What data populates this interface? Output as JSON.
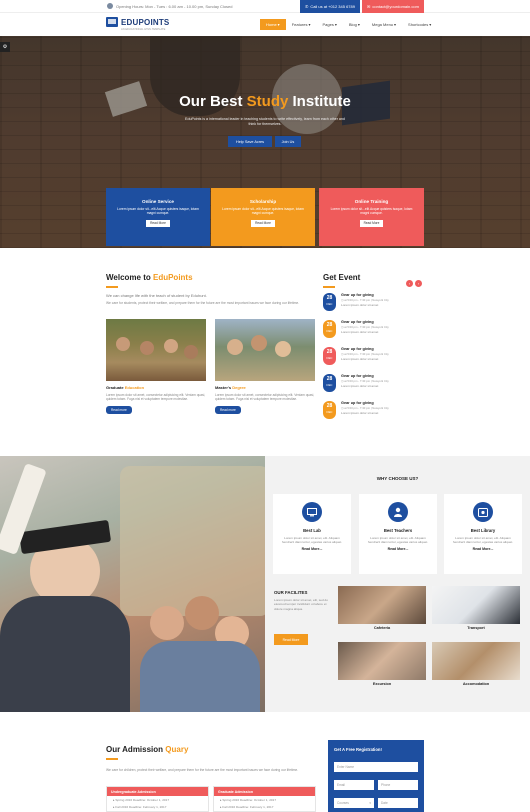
{
  "topbar": {
    "hours": "Opening Hours: Mon - Tues : 6.00 am - 10.00 pm, Sunday Closed",
    "call": "Call us at +012 345 6789",
    "email": "contact@yourdomain.com"
  },
  "header": {
    "logo_name": "EDUPOINTS",
    "logo_tagline": "AN EDUCATIONAL HTML TEMPLATE",
    "nav": [
      "Home",
      "Features",
      "Pages",
      "Blog",
      "Mega Menu",
      "Shortcodes"
    ]
  },
  "hero": {
    "title_pre": "Our Best",
    "title_accent": "Study",
    "title_post": "Institute",
    "subtitle": "EduPoints is a international leader in teaching students to write effectively, learn from each other and think for themselves.",
    "help_button": "Help Save Acres",
    "join_button": "Join Us"
  },
  "services": [
    {
      "title": "Online Service",
      "text": "Lorem ipsum dolor sit...elit.Acque quisters isaque, lotam magni cumque.",
      "button": "Read More"
    },
    {
      "title": "Scholarship",
      "text": "Lorem ipsum dolor sit...elit.Acque quisters isaque, lotam magni cumque.",
      "button": "Read More"
    },
    {
      "title": "Online Training",
      "text": "Lorem ipsum dolor sit...elit.Acque quisters isaque, lotam magni cumque.",
      "button": "Read More"
    }
  ],
  "welcome": {
    "title_pre": "Welcome to",
    "title_accent": "EduPoints",
    "lead": "We can change life with the teach of student by Eduhunt.",
    "body": "We care for students, protect their welfare, and prepare them for the future are the most important issues we face during our lifetime.",
    "courses": [
      {
        "title_pre": "Graduate",
        "title_accent": "Education",
        "text": "Lorem ipsum dolor sit amet, consectetur adipisicing elit. Veniam quasi, quidem totam. Fuga nisi et voluptatem tempore molestiae.",
        "button": "Read more"
      },
      {
        "title_pre": "Master's",
        "title_accent": "Degree",
        "text": "Lorem ipsum dolor sit amet, consectetur adipisicing elit. Veniam quasi, quidem totam. Fuga nisi et voluptatem tempore molestiae.",
        "button": "Read more"
      }
    ]
  },
  "events": {
    "title": "Get Event",
    "items": [
      {
        "day": "28",
        "month": "DEC",
        "title": "Gear up for giving",
        "meta": "at 5:00 pm - 7:30 pm  |  Newyork City",
        "desc": "Lorem ipsum dolor sit amet",
        "color": "#1e4fa0"
      },
      {
        "day": "28",
        "month": "DEC",
        "title": "Gear up for giving",
        "meta": "at 5:00 pm - 7:30 pm  |  Newyork City",
        "desc": "Lorem ipsum dolor sit amet",
        "color": "#f39a1e"
      },
      {
        "day": "28",
        "month": "DEC",
        "title": "Gear up for giving",
        "meta": "at 5:00 pm - 7:30 pm  |  Newyork City",
        "desc": "Lorem ipsum dolor sit amet",
        "color": "#ef5b5b"
      },
      {
        "day": "28",
        "month": "DEC",
        "title": "Gear up for giving",
        "meta": "at 5:00 pm - 7:30 pm  |  Newyork City",
        "desc": "Lorem ipsum dolor sit amet",
        "color": "#1e4fa0"
      },
      {
        "day": "28",
        "month": "DEC",
        "title": "Gear up for giving",
        "meta": "at 5:00 pm - 7:30 pm  |  Newyork City",
        "desc": "Lorem ipsum dolor sit amet",
        "color": "#f39a1e"
      }
    ]
  },
  "why": {
    "title": "WHY CHOOSE US?",
    "cards": [
      {
        "title": "Best Lab",
        "text": "Lorem ipsum dolor sit amet, elit. Aliquam hendrerit diam tortor, egestas varius aliquet.",
        "button": "Read More...",
        "icon": "monitor-icon"
      },
      {
        "title": "Best Teachers",
        "text": "Lorem ipsum dolor sit amet, elit. Aliquam hendrerit diam tortor, egestas varius aliquet.",
        "button": "Read More...",
        "icon": "user-icon"
      },
      {
        "title": "Best Library",
        "text": "Lorem ipsum dolor sit amet, elit. Aliquam hendrerit diam tortor, egestas varius aliquet.",
        "button": "Read More...",
        "icon": "book-icon"
      }
    ],
    "facilities_title": "OUR FACILITES",
    "facilities_text": "Lorem ipsum dolor sit amet, elit, sed do eiusmod tempor incididunt ut labore et dolore magna aliqua.",
    "facilities_button": "Read More",
    "facilities": [
      "Cafeteria",
      "Transport",
      "Excursion",
      "Accomodation"
    ]
  },
  "admission": {
    "title_pre": "Our Admission",
    "title_accent": "Quary",
    "text": "We care for children, protect their welfare, and prepare them for the future are the most important issues we face during our lifetime.",
    "boxes": [
      {
        "title": "Undergraduate Admission",
        "items": [
          "Spring 2016 Deadline: October 1, 2017",
          "Fall 2016 Deadline: February 1, 2017"
        ]
      },
      {
        "title": "Graduate Admission",
        "items": [
          "Spring 2016 Deadline: October 1, 2017",
          "Fall 2016 Deadline: February 1, 2017"
        ]
      }
    ],
    "form": {
      "title": "Get A Free Registration!",
      "name_placeholder": "Enter Name",
      "email_placeholder": "Email",
      "phone_placeholder": "Phone",
      "course_placeholder": "Courses",
      "date_placeholder": "Date"
    }
  },
  "colors": {
    "blue": "#1e4fa0",
    "orange": "#f39a1e",
    "red": "#ef5b5b"
  }
}
